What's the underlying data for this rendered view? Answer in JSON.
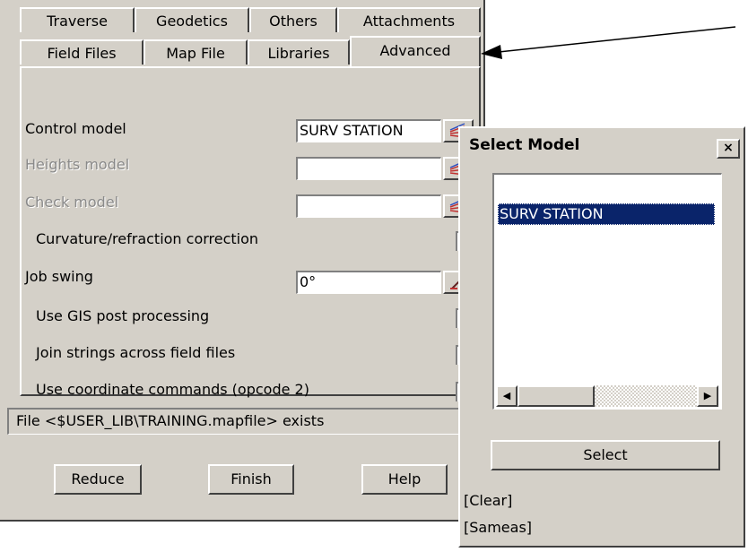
{
  "tabs_row1": [
    "Traverse",
    "Geodetics",
    "Others",
    "Attachments"
  ],
  "tabs_row2": [
    "Field Files",
    "Map File",
    "Libraries",
    "Advanced"
  ],
  "fields": {
    "control_model": {
      "label": "Control model",
      "value": "SURV STATION"
    },
    "heights_model": {
      "label": "Heights model",
      "value": ""
    },
    "check_model": {
      "label": "Check model",
      "value": ""
    },
    "curvature": {
      "label": "Curvature/refraction correction"
    },
    "job_swing": {
      "label": "Job swing",
      "value": "0°"
    },
    "gis": {
      "label": "Use GIS post processing"
    },
    "join": {
      "label": "Join strings across field files"
    },
    "coord": {
      "label": "Use coordinate commands (opcode 2)"
    }
  },
  "status": "File <$USER_LIB\\TRAINING.mapfile> exists",
  "buttons": {
    "reduce": "Reduce",
    "finish": "Finish",
    "help": "Help"
  },
  "popup": {
    "title": "Select Model",
    "close": "×",
    "items": [
      "SURV STATION"
    ],
    "select_label": "Select",
    "clear": "[Clear]",
    "sameas": "[Sameas]"
  },
  "colors": {
    "dialog_bg": "#d4d0c8",
    "selection": "#0a246a"
  },
  "icons": {
    "pick": "model-picker-icon",
    "swing": "angle-picker-icon",
    "arrow": "callout-arrow"
  }
}
